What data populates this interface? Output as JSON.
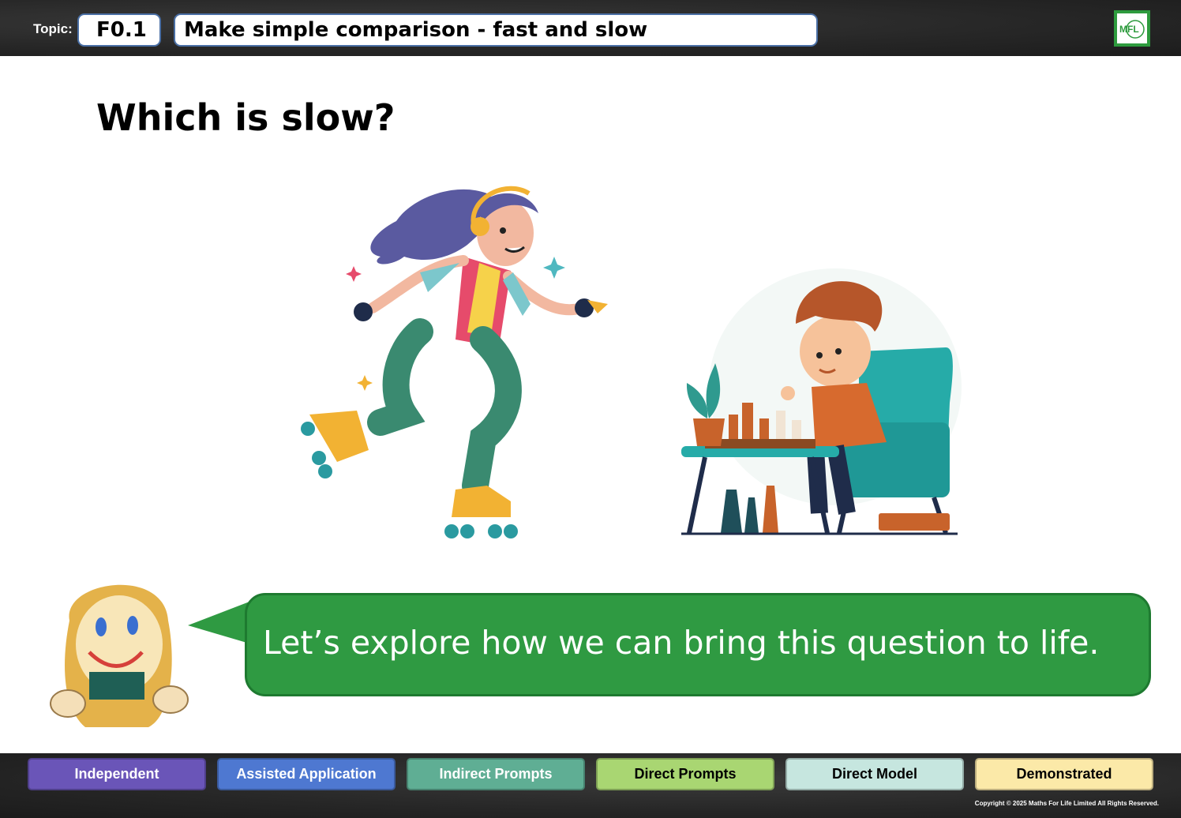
{
  "header": {
    "topic_label": "Topic:",
    "topic_code": "F0.1",
    "topic_title": "Make simple comparison - fast and slow",
    "logo_text": "MFL",
    "logo_color": "#2e9b3e"
  },
  "main": {
    "question": "Which is slow?",
    "images": [
      {
        "icon": "roller-skating-girl-illustration"
      },
      {
        "icon": "boy-playing-chess-illustration"
      }
    ],
    "speech_bubble": {
      "text": "Let’s explore how we can bring this question to life.",
      "color": "#2f9a42"
    }
  },
  "footer": {
    "levels": [
      {
        "label": "Independent",
        "color": "#6a55b8",
        "text_color": "#ffffff"
      },
      {
        "label": "Assisted Application",
        "color": "#4e78d1",
        "text_color": "#ffffff"
      },
      {
        "label": "Indirect Prompts",
        "color": "#5fae94",
        "text_color": "#ffffff"
      },
      {
        "label": "Direct Prompts",
        "color": "#a9d672",
        "text_color": "#000000"
      },
      {
        "label": "Direct Model",
        "color": "#c6e6df",
        "text_color": "#000000"
      },
      {
        "label": "Demonstrated",
        "color": "#fbe9a8",
        "text_color": "#000000"
      }
    ],
    "copyright": "Copyright © 2025 Maths For Life Limited All Rights Reserved."
  }
}
